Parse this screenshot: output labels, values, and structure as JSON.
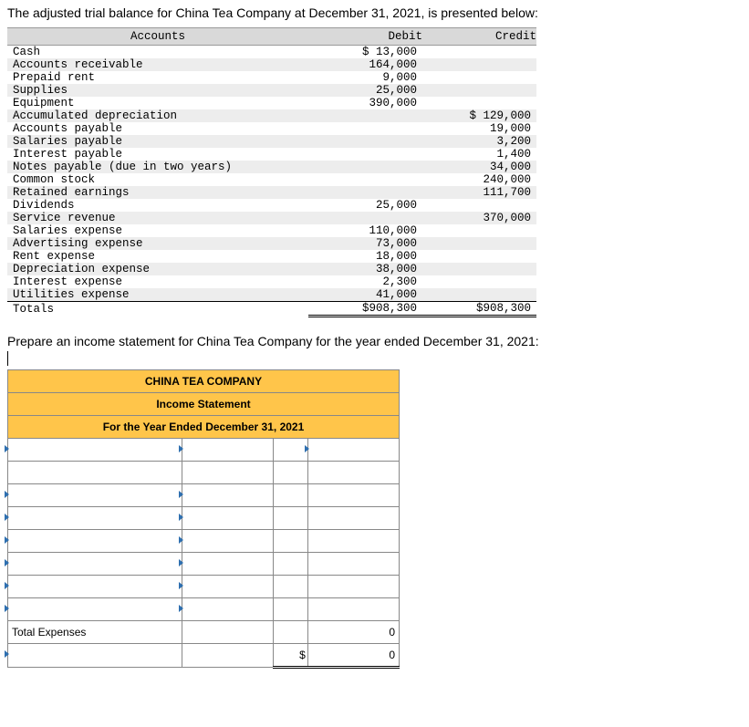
{
  "intro": "The adjusted trial balance for China Tea Company at December 31, 2021, is presented below:",
  "tb": {
    "headers": {
      "accounts": "Accounts",
      "debit": "Debit",
      "credit": "Credit"
    },
    "rows": [
      {
        "a": "Cash",
        "d": "$ 13,000",
        "c": ""
      },
      {
        "a": "Accounts receivable",
        "d": "164,000",
        "c": ""
      },
      {
        "a": "Prepaid rent",
        "d": "9,000",
        "c": ""
      },
      {
        "a": "Supplies",
        "d": "25,000",
        "c": ""
      },
      {
        "a": "Equipment",
        "d": "390,000",
        "c": ""
      },
      {
        "a": "Accumulated depreciation",
        "d": "",
        "c": "$ 129,000"
      },
      {
        "a": "Accounts payable",
        "d": "",
        "c": "19,000"
      },
      {
        "a": "Salaries payable",
        "d": "",
        "c": "3,200"
      },
      {
        "a": "Interest payable",
        "d": "",
        "c": "1,400"
      },
      {
        "a": "Notes payable (due in two years)",
        "d": "",
        "c": "34,000"
      },
      {
        "a": "Common stock",
        "d": "",
        "c": "240,000"
      },
      {
        "a": "Retained earnings",
        "d": "",
        "c": "111,700"
      },
      {
        "a": "Dividends",
        "d": "25,000",
        "c": ""
      },
      {
        "a": "Service revenue",
        "d": "",
        "c": "370,000"
      },
      {
        "a": "Salaries expense",
        "d": "110,000",
        "c": ""
      },
      {
        "a": "Advertising expense",
        "d": "73,000",
        "c": ""
      },
      {
        "a": "Rent expense",
        "d": "18,000",
        "c": ""
      },
      {
        "a": "Depreciation expense",
        "d": "38,000",
        "c": ""
      },
      {
        "a": "Interest expense",
        "d": "2,300",
        "c": ""
      },
      {
        "a": "Utilities expense",
        "d": "41,000",
        "c": ""
      }
    ],
    "totals": {
      "label": "Totals",
      "d": "$908,300",
      "c": "$908,300"
    }
  },
  "prep": "Prepare an income statement for China Tea Company for the year ended December 31, 2021:",
  "ws": {
    "h1": "CHINA TEA COMPANY",
    "h2": "Income Statement",
    "h3": "For the Year Ended December 31, 2021",
    "total_expenses_label": "Total Expenses",
    "zero": "0",
    "dollar": "$"
  }
}
